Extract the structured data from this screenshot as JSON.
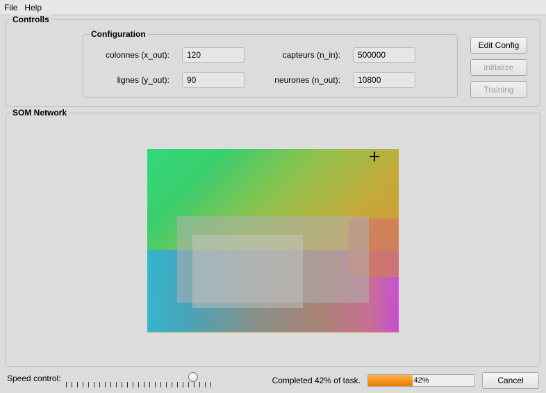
{
  "menu": {
    "file": "File",
    "help": "Help"
  },
  "controls": {
    "title": "Controlls",
    "config": {
      "title": "Configuration",
      "labels": {
        "colonnes": "colonnes (x_out):",
        "lignes": "lignes (y_out):",
        "capteurs": "capteurs (n_in):",
        "neurones": "neurones (n_out):"
      },
      "values": {
        "colonnes": "120",
        "lignes": "90",
        "capteurs": "500000",
        "neurones": "10800"
      }
    },
    "buttons": {
      "edit_config": "Edit Config",
      "initialize": "initialize",
      "training": "Training"
    }
  },
  "som": {
    "title": "SOM Network"
  },
  "footer": {
    "speed_label": "Speed control:",
    "slider_fraction": 0.87,
    "status": "Completed 42% of task.",
    "progress_percent": 42,
    "progress_text": "42%",
    "cancel": "Cancel"
  },
  "colors": {
    "accent_progress": "#f28c00"
  }
}
